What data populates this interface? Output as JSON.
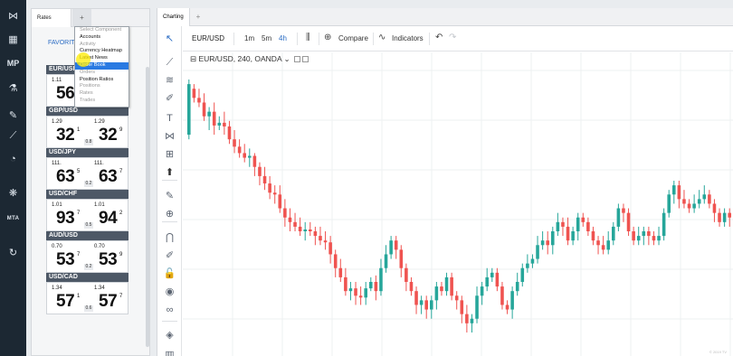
{
  "nav": {
    "items": [
      {
        "name": "logo-icon",
        "glyph": "⋈"
      },
      {
        "name": "dashboard-icon",
        "glyph": "▦"
      },
      {
        "name": "mp-icon",
        "label": "MP"
      },
      {
        "name": "flask-icon",
        "glyph": "⚗"
      },
      {
        "name": "pencil-icon",
        "glyph": "✎"
      },
      {
        "name": "signal-icon",
        "glyph": "⟋"
      },
      {
        "name": "gauge-icon",
        "glyph": "◔"
      },
      {
        "name": "settings-icon",
        "glyph": "❋"
      },
      {
        "name": "mta-icon",
        "label": "MTA"
      },
      {
        "name": "refresh-icon",
        "glyph": "↻"
      }
    ]
  },
  "rates_panel": {
    "tab_label": "Rates",
    "add_tab": "+",
    "subtab": "FAVORIT",
    "pairs": [
      {
        "name": "EUR/USD",
        "bid_small": "1.11",
        "bid_big": "56",
        "bid_sup": "",
        "ask_small": "",
        "ask_big": "",
        "ask_sup": "",
        "spread": ""
      },
      {
        "name": "GBP/USD",
        "bid_small": "1.29",
        "bid_big": "32",
        "bid_sup": "1",
        "ask_small": "1.29",
        "ask_big": "32",
        "ask_sup": "9",
        "spread": "0.8"
      },
      {
        "name": "USD/JPY",
        "bid_small": "111.",
        "bid_big": "63",
        "bid_sup": "5",
        "ask_small": "111.",
        "ask_big": "63",
        "ask_sup": "7",
        "spread": "0.2"
      },
      {
        "name": "USD/CHF",
        "bid_small": "1.01",
        "bid_big": "93",
        "bid_sup": "7",
        "ask_small": "1.01",
        "ask_big": "94",
        "ask_sup": "2",
        "spread": "0.5"
      },
      {
        "name": "AUD/USD",
        "bid_small": "0.70",
        "bid_big": "53",
        "bid_sup": "7",
        "ask_small": "0.70",
        "ask_big": "53",
        "ask_sup": "9",
        "spread": "0.2"
      },
      {
        "name": "USD/CAD",
        "bid_small": "1.34",
        "bid_big": "57",
        "bid_sup": "1",
        "ask_small": "1.34",
        "ask_big": "57",
        "ask_sup": "7",
        "spread": "0.6"
      }
    ]
  },
  "component_menu": {
    "items": [
      {
        "label": "Select Component",
        "state": "disabled"
      },
      {
        "label": "Accounts",
        "state": "enabled"
      },
      {
        "label": "Activity",
        "state": "disabled"
      },
      {
        "label": "Currency Heatmap",
        "state": "enabled"
      },
      {
        "label": "Latest News",
        "state": "enabled"
      },
      {
        "label": "Order Book",
        "state": "selected"
      },
      {
        "label": "Orders",
        "state": "disabled"
      },
      {
        "label": "Position Ratios",
        "state": "enabled"
      },
      {
        "label": "Positions",
        "state": "disabled"
      },
      {
        "label": "Rates",
        "state": "disabled"
      },
      {
        "label": "Trades",
        "state": "disabled"
      }
    ]
  },
  "charting": {
    "tab_label": "Charting",
    "add_tab": "+",
    "symbol": "EUR/USD",
    "intervals": [
      {
        "label": "1m",
        "active": false
      },
      {
        "label": "5m",
        "active": false
      },
      {
        "label": "4h",
        "active": true
      }
    ],
    "compare_label": "Compare",
    "indicators_label": "Indicators",
    "legend_text": "EUR/USD, 240, OANDA",
    "watermark": "© 2019 TV",
    "tools": [
      "cursor-icon",
      "trendline-icon",
      "fib-icon",
      "brush-icon",
      "text-icon",
      "pattern-icon",
      "measure-tools-icon",
      "arrow-up-icon",
      "ruler-icon",
      "zoom-icon",
      "magnet-icon",
      "lock-draw-icon",
      "lock-icon",
      "eye-icon",
      "link-icon",
      "layers-icon",
      "trash-icon"
    ]
  },
  "chart_data": {
    "type": "candlestick",
    "symbol": "EUR/USD",
    "interval": "240",
    "source": "OANDA",
    "colors": {
      "up": "#26a69a",
      "down": "#ef5350"
    },
    "candles": [
      [
        95,
        40,
        35,
        100
      ],
      [
        45,
        55,
        40,
        60
      ],
      [
        55,
        60,
        45,
        65
      ],
      [
        60,
        75,
        50,
        80
      ],
      [
        75,
        70,
        65,
        90
      ],
      [
        70,
        85,
        60,
        95
      ],
      [
        85,
        82,
        75,
        90
      ],
      [
        82,
        86,
        70,
        95
      ],
      [
        86,
        100,
        80,
        105
      ],
      [
        100,
        108,
        90,
        115
      ],
      [
        108,
        115,
        100,
        120
      ],
      [
        115,
        120,
        105,
        125
      ],
      [
        120,
        118,
        110,
        130
      ],
      [
        118,
        130,
        115,
        140
      ],
      [
        130,
        140,
        125,
        150
      ],
      [
        140,
        148,
        130,
        155
      ],
      [
        148,
        158,
        140,
        165
      ],
      [
        158,
        160,
        150,
        170
      ],
      [
        160,
        175,
        150,
        180
      ],
      [
        175,
        185,
        165,
        195
      ],
      [
        185,
        190,
        175,
        200
      ],
      [
        190,
        195,
        180,
        200
      ],
      [
        195,
        200,
        185,
        205
      ],
      [
        200,
        198,
        190,
        210
      ],
      [
        198,
        200,
        190,
        205
      ],
      [
        200,
        205,
        195,
        215
      ],
      [
        205,
        210,
        195,
        215
      ],
      [
        210,
        212,
        200,
        220
      ],
      [
        212,
        225,
        205,
        235
      ],
      [
        225,
        240,
        220,
        250
      ],
      [
        240,
        250,
        230,
        255
      ],
      [
        250,
        265,
        240,
        270
      ],
      [
        265,
        262,
        255,
        275
      ],
      [
        262,
        270,
        255,
        280
      ],
      [
        270,
        272,
        260,
        280
      ],
      [
        272,
        262,
        255,
        280
      ],
      [
        262,
        255,
        250,
        265
      ],
      [
        255,
        265,
        248,
        275
      ],
      [
        265,
        240,
        230,
        270
      ],
      [
        240,
        225,
        215,
        245
      ],
      [
        225,
        210,
        205,
        230
      ],
      [
        210,
        220,
        205,
        230
      ],
      [
        220,
        240,
        215,
        250
      ],
      [
        240,
        255,
        235,
        265
      ],
      [
        255,
        265,
        250,
        270
      ],
      [
        265,
        280,
        260,
        290
      ],
      [
        280,
        275,
        270,
        290
      ],
      [
        275,
        285,
        270,
        295
      ],
      [
        285,
        275,
        270,
        295
      ],
      [
        275,
        260,
        255,
        285
      ],
      [
        260,
        265,
        255,
        270
      ],
      [
        265,
        250,
        245,
        270
      ],
      [
        250,
        270,
        245,
        275
      ],
      [
        270,
        275,
        265,
        285
      ],
      [
        275,
        290,
        270,
        300
      ],
      [
        290,
        300,
        280,
        310
      ],
      [
        300,
        295,
        290,
        310
      ],
      [
        295,
        270,
        260,
        300
      ],
      [
        270,
        260,
        255,
        280
      ],
      [
        260,
        250,
        240,
        265
      ],
      [
        250,
        245,
        240,
        255
      ],
      [
        245,
        260,
        240,
        265
      ],
      [
        260,
        280,
        255,
        285
      ],
      [
        280,
        285,
        275,
        290
      ],
      [
        285,
        265,
        260,
        295
      ],
      [
        265,
        255,
        245,
        270
      ],
      [
        255,
        240,
        235,
        260
      ],
      [
        240,
        235,
        225,
        245
      ],
      [
        235,
        230,
        225,
        240
      ],
      [
        230,
        215,
        205,
        235
      ],
      [
        215,
        210,
        200,
        220
      ],
      [
        210,
        215,
        200,
        225
      ],
      [
        215,
        200,
        195,
        225
      ],
      [
        200,
        190,
        180,
        205
      ],
      [
        190,
        195,
        185,
        205
      ],
      [
        195,
        210,
        185,
        215
      ],
      [
        210,
        200,
        195,
        215
      ],
      [
        200,
        185,
        180,
        210
      ],
      [
        185,
        190,
        180,
        195
      ],
      [
        190,
        200,
        185,
        205
      ],
      [
        200,
        210,
        195,
        215
      ],
      [
        210,
        215,
        205,
        225
      ],
      [
        215,
        220,
        205,
        225
      ],
      [
        220,
        210,
        200,
        225
      ],
      [
        210,
        195,
        190,
        215
      ],
      [
        195,
        175,
        170,
        200
      ],
      [
        175,
        180,
        170,
        190
      ],
      [
        180,
        200,
        175,
        205
      ],
      [
        200,
        210,
        195,
        215
      ],
      [
        210,
        205,
        195,
        215
      ],
      [
        205,
        200,
        195,
        215
      ],
      [
        200,
        205,
        195,
        215
      ],
      [
        205,
        210,
        200,
        215
      ],
      [
        210,
        205,
        195,
        215
      ],
      [
        205,
        180,
        175,
        210
      ],
      [
        180,
        160,
        155,
        185
      ],
      [
        160,
        150,
        145,
        170
      ],
      [
        150,
        165,
        145,
        175
      ],
      [
        165,
        170,
        155,
        175
      ],
      [
        170,
        175,
        165,
        180
      ],
      [
        175,
        170,
        160,
        180
      ],
      [
        170,
        165,
        155,
        175
      ],
      [
        165,
        160,
        150,
        170
      ],
      [
        160,
        170,
        155,
        175
      ],
      [
        170,
        180,
        165,
        190
      ],
      [
        180,
        190,
        175,
        195
      ],
      [
        190,
        180,
        175,
        195
      ],
      [
        180,
        185,
        175,
        195
      ]
    ]
  }
}
